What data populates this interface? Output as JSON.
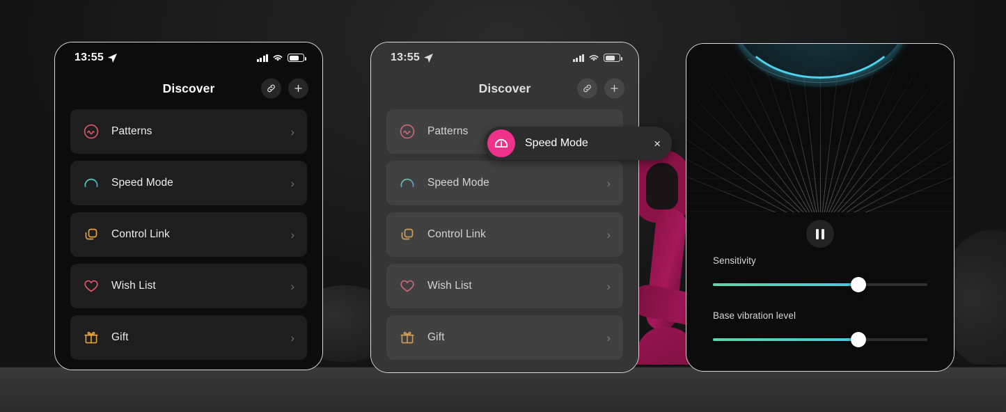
{
  "colors": {
    "accent_pink": "#f0328c",
    "patterns_icon": "#e2576b",
    "speed_icon": "#45c8e0",
    "control_link_icon": "#e8a33c",
    "wish_list_icon": "#e2576b",
    "gift_icon": "#e8a33c",
    "slider_fill_start": "#5fd6a8",
    "slider_fill_end": "#45c8e0",
    "arc_cyan": "#4fd2ee",
    "card_bg": "#1e1e1e",
    "screen_bg": "#0c0c0c"
  },
  "panels": [
    {
      "id": "panel-discover",
      "status_bar": {
        "time": "13:55",
        "location_icon": "location-arrow-icon",
        "signal_icon": "cellular-bars-icon",
        "wifi_icon": "wifi-icon",
        "battery_icon": "battery-icon"
      },
      "header": {
        "title": "Discover",
        "actions": [
          {
            "name": "link-button",
            "icon": "link-icon"
          },
          {
            "name": "add-button",
            "icon": "plus-icon"
          }
        ]
      },
      "list": [
        {
          "label": "Patterns",
          "icon": "wave-circle-icon",
          "chevron": "›"
        },
        {
          "label": "Speed Mode",
          "icon": "speedometer-icon",
          "chevron": "›"
        },
        {
          "label": "Control Link",
          "icon": "link-squares-icon",
          "chevron": "›"
        },
        {
          "label": "Wish List",
          "icon": "heart-icon",
          "chevron": "›"
        },
        {
          "label": "Gift",
          "icon": "gift-icon",
          "chevron": "›"
        }
      ]
    },
    {
      "id": "panel-discover-toast",
      "status_bar": {
        "time": "13:55",
        "location_icon": "location-arrow-icon",
        "signal_icon": "cellular-bars-icon",
        "wifi_icon": "wifi-icon",
        "battery_icon": "battery-icon"
      },
      "header": {
        "title": "Discover",
        "actions": [
          {
            "name": "link-button",
            "icon": "link-icon"
          },
          {
            "name": "add-button",
            "icon": "plus-icon"
          }
        ]
      },
      "list": [
        {
          "label": "Patterns",
          "icon": "wave-circle-icon",
          "chevron": "›"
        },
        {
          "label": "Speed Mode",
          "icon": "speedometer-icon",
          "chevron": "›"
        },
        {
          "label": "Control Link",
          "icon": "link-squares-icon",
          "chevron": "›"
        },
        {
          "label": "Wish List",
          "icon": "heart-icon",
          "chevron": "›"
        },
        {
          "label": "Gift",
          "icon": "gift-icon",
          "chevron": "›"
        }
      ],
      "toast": {
        "label": "Speed Mode",
        "badge_icon": "speedometer-icon",
        "close_label": "×"
      }
    },
    {
      "id": "panel-speed-mode",
      "visualizer": {
        "arc_icon": "cyan-arc",
        "grid": "perspective-grid"
      },
      "transport": {
        "button": "pause-button",
        "icon": "pause-icon"
      },
      "sliders": [
        {
          "label": "Sensitivity",
          "value": 68
        },
        {
          "label": "Base vibration level",
          "value": 68
        }
      ]
    }
  ]
}
